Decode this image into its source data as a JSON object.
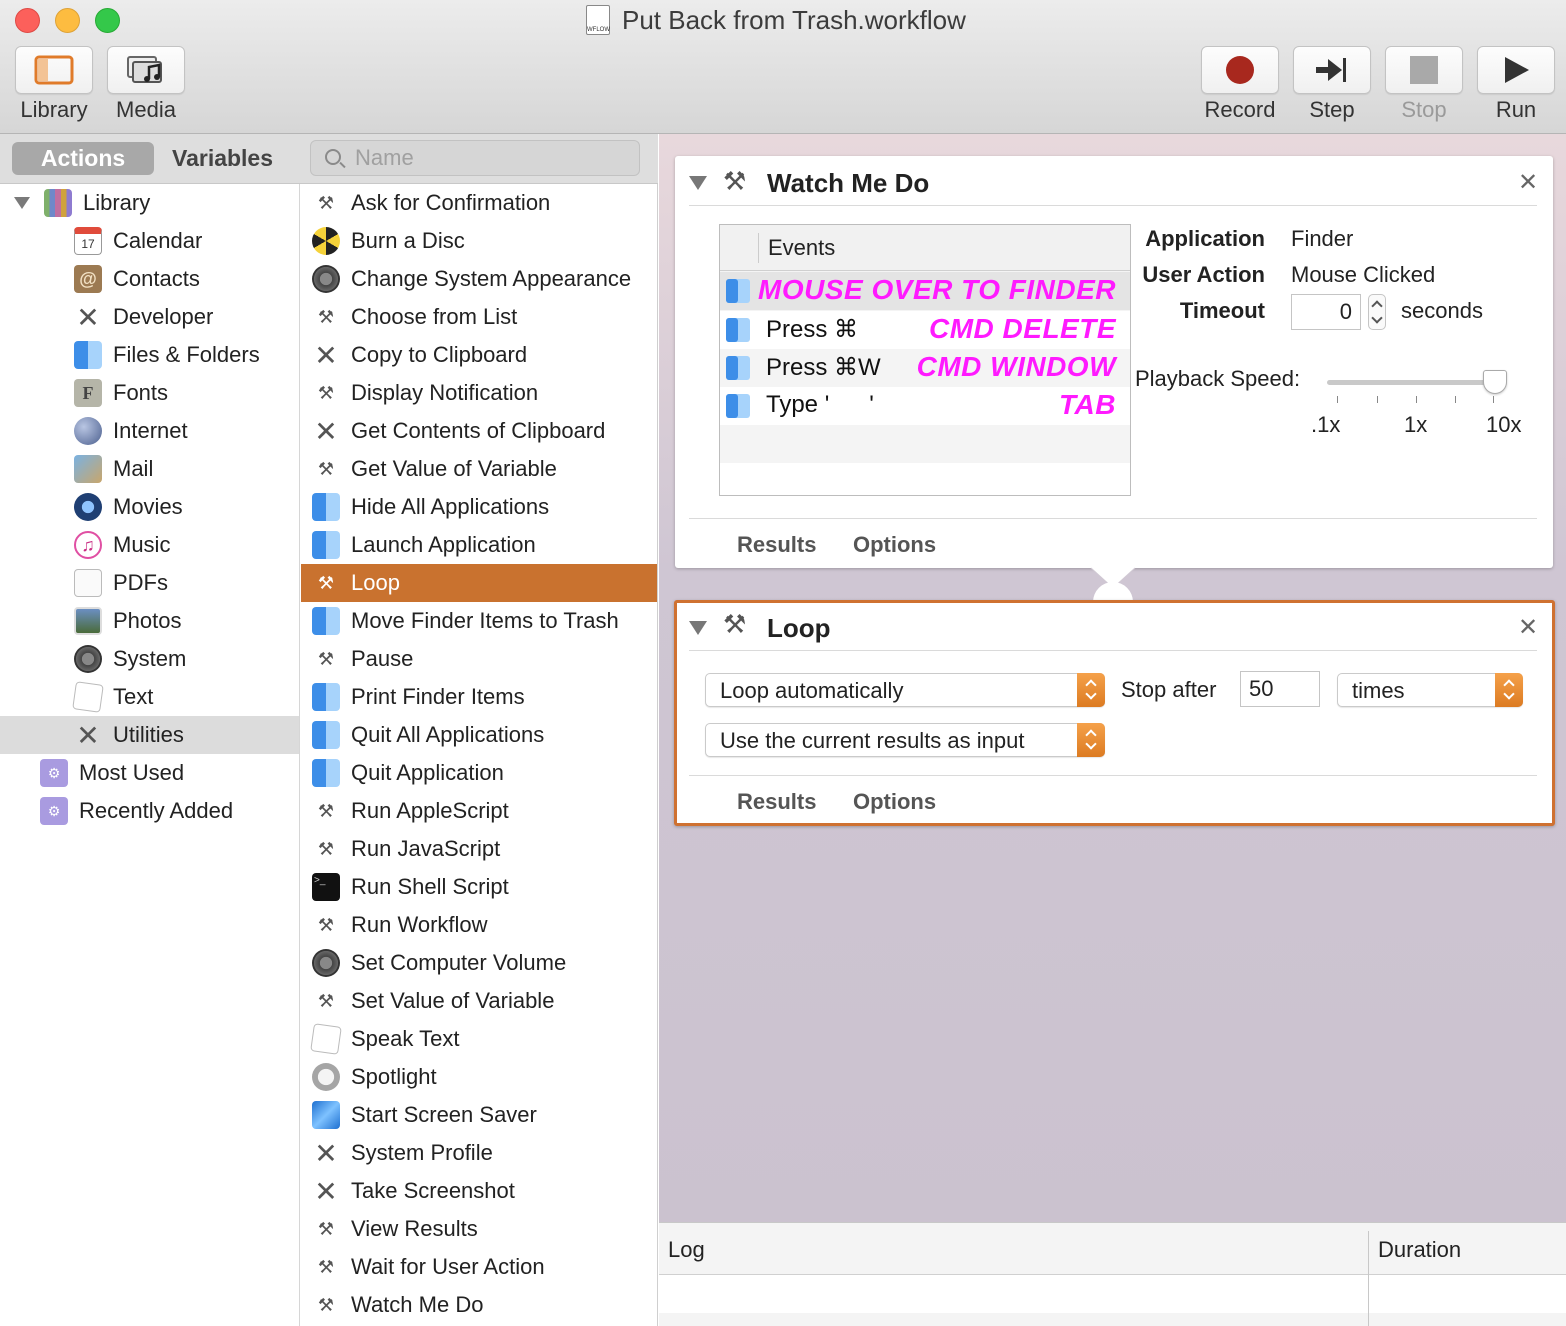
{
  "window": {
    "title": "Put Back from Trash.workflow",
    "doc_icon_label": "WFLOW"
  },
  "toolbar": {
    "left": [
      {
        "label": "Library",
        "icon": "library-icon"
      },
      {
        "label": "Media",
        "icon": "media-icon"
      }
    ],
    "right": [
      {
        "label": "Record",
        "icon": "record-icon"
      },
      {
        "label": "Step",
        "icon": "step-icon"
      },
      {
        "label": "Stop",
        "icon": "stop-icon",
        "disabled": true
      },
      {
        "label": "Run",
        "icon": "run-icon"
      }
    ]
  },
  "tabs": {
    "actions": "Actions",
    "variables": "Variables"
  },
  "search": {
    "placeholder": "Name"
  },
  "library": {
    "root": "Library",
    "items": [
      "Calendar",
      "Contacts",
      "Developer",
      "Files & Folders",
      "Fonts",
      "Internet",
      "Mail",
      "Movies",
      "Music",
      "PDFs",
      "Photos",
      "System",
      "Text",
      "Utilities"
    ],
    "selected": "Utilities",
    "extras": [
      "Most Used",
      "Recently Added"
    ]
  },
  "actions": {
    "items": [
      "Ask for Confirmation",
      "Burn a Disc",
      "Change System Appearance",
      "Choose from List",
      "Copy to Clipboard",
      "Display Notification",
      "Get Contents of Clipboard",
      "Get Value of Variable",
      "Hide All Applications",
      "Launch Application",
      "Loop",
      "Move Finder Items to Trash",
      "Pause",
      "Print Finder Items",
      "Quit All Applications",
      "Quit Application",
      "Run AppleScript",
      "Run JavaScript",
      "Run Shell Script",
      "Run Workflow",
      "Set Computer Volume",
      "Set Value of Variable",
      "Speak Text",
      "Spotlight",
      "Start Screen Saver",
      "System Profile",
      "Take Screenshot",
      "View Results",
      "Wait for User Action",
      "Watch Me Do"
    ],
    "selected": "Loop"
  },
  "watch_me_do": {
    "title": "Watch Me Do",
    "events_header": "Events",
    "events": [
      {
        "text": "",
        "note": "MOUSE OVER TO FINDER"
      },
      {
        "text": "Press ⌘",
        "note": "CMD DELETE"
      },
      {
        "text": "Press ⌘W",
        "note": "CMD WINDOW"
      },
      {
        "text": "Type '      '",
        "note": "TAB"
      }
    ],
    "application_label": "Application",
    "application_value": "Finder",
    "user_action_label": "User Action",
    "user_action_value": "Mouse Clicked",
    "timeout_label": "Timeout",
    "timeout_value": "0",
    "timeout_unit": "seconds",
    "playback_label": "Playback Speed:",
    "playback_ticks": [
      ".1x",
      "1x",
      "10x"
    ],
    "playback_level": 1.0,
    "results_tab": "Results",
    "options_tab": "Options"
  },
  "loop": {
    "title": "Loop",
    "mode": "Loop automatically",
    "stop_after_label": "Stop after",
    "stop_after_value": "50",
    "unit": "times",
    "input_mode": "Use the current results as input",
    "results_tab": "Results",
    "options_tab": "Options"
  },
  "log": {
    "log_col": "Log",
    "duration_col": "Duration"
  },
  "colors": {
    "accent": "#c9722f",
    "annotation": "#ff1aff",
    "record": "#a8281e"
  }
}
